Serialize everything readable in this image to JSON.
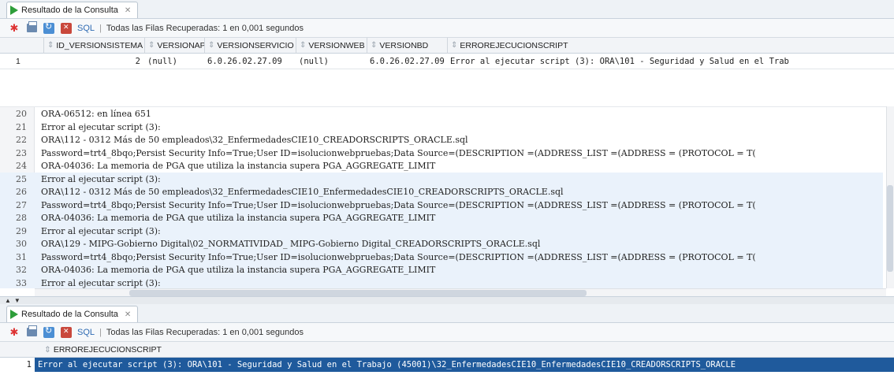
{
  "top": {
    "tab_title": "Resultado de la Consulta",
    "tab_close": "✕",
    "toolbar": {
      "sql_label": "SQL",
      "separator": "|",
      "status": "Todas las Filas Recuperadas: 1 en 0,001 segundos"
    },
    "columns": [
      "ID_VERSIONSISTEMA",
      "VERSIONAPI",
      "VERSIONSERVICIO",
      "VERSIONWEB",
      "VERSIONBD",
      "ERROREJECUCIONSCRIPT"
    ],
    "row": {
      "num": "1",
      "id": "2",
      "api": "(null)",
      "servicio": "6.0.26.02.27.09",
      "web": "(null)",
      "bd": "6.0.26.02.27.09",
      "error": "Error al ejecutar script (3): ORA\\101 - Seguridad y Salud en el Trab"
    }
  },
  "editor": {
    "lines": [
      {
        "num": "20",
        "text": "ORA-06512: en línea 651"
      },
      {
        "num": "21",
        "text": "Error al ejecutar script (3):"
      },
      {
        "num": "22",
        "text": "ORA\\112 - 0312 Más de 50 empleados\\32_EnfermedadesCIE10_CREADORSCRIPTS_ORACLE.sql"
      },
      {
        "num": "23",
        "text": "Password=trt4_8bqo;Persist Security Info=True;User ID=isolucionwebpruebas;Data Source=(DESCRIPTION =(ADDRESS_LIST =(ADDRESS = (PROTOCOL = T("
      },
      {
        "num": "24",
        "text": "ORA-04036: La memoria de PGA que utiliza la instancia supera PGA_AGGREGATE_LIMIT"
      },
      {
        "num": "25",
        "text": "Error al ejecutar script (3):"
      },
      {
        "num": "26",
        "text": "ORA\\112 - 0312 Más de 50 empleados\\32_EnfermedadesCIE10_EnfermedadesCIE10_CREADORSCRIPTS_ORACLE.sql"
      },
      {
        "num": "27",
        "text": "Password=trt4_8bqo;Persist Security Info=True;User ID=isolucionwebpruebas;Data Source=(DESCRIPTION =(ADDRESS_LIST =(ADDRESS = (PROTOCOL = T("
      },
      {
        "num": "28",
        "text": "ORA-04036: La memoria de PGA que utiliza la instancia supera PGA_AGGREGATE_LIMIT"
      },
      {
        "num": "29",
        "text": "Error al ejecutar script (3):"
      },
      {
        "num": "30",
        "text": "ORA\\129 - MIPG-Gobierno Digital\\02_NORMATIVIDAD_ MIPG-Gobierno Digital_CREADORSCRIPTS_ORACLE.sql"
      },
      {
        "num": "31",
        "text": "Password=trt4_8bqo;Persist Security Info=True;User ID=isolucionwebpruebas;Data Source=(DESCRIPTION =(ADDRESS_LIST =(ADDRESS = (PROTOCOL = T("
      },
      {
        "num": "32",
        "text": "ORA-04036: La memoria de PGA que utiliza la instancia supera PGA_AGGREGATE_LIMIT"
      },
      {
        "num": "33",
        "text": "Error al ejecutar script (3):"
      }
    ]
  },
  "bottom": {
    "tab_title": "Resultado de la Consulta",
    "tab_close": "✕",
    "toolbar": {
      "sql_label": "SQL",
      "separator": "|",
      "status": "Todas las Filas Recuperadas: 1 en 0,001 segundos"
    },
    "column": "ERROREJECUCIONSCRIPT",
    "row": {
      "num": "1",
      "text": "Error al ejecutar script (3): ORA\\101 - Seguridad y Salud en el Trabajo (45001)\\32_EnfermedadesCIE10_EnfermedadesCIE10_CREADORSCRIPTS_ORACLE"
    }
  },
  "icons": [
    "play-icon",
    "pin-icon",
    "print-icon",
    "refresh-icon",
    "cancel-icon",
    "sort-icon"
  ],
  "colors": {
    "selection": "#1f5a9c",
    "link": "#2f6bb3",
    "run_green": "#2e9e3a"
  }
}
